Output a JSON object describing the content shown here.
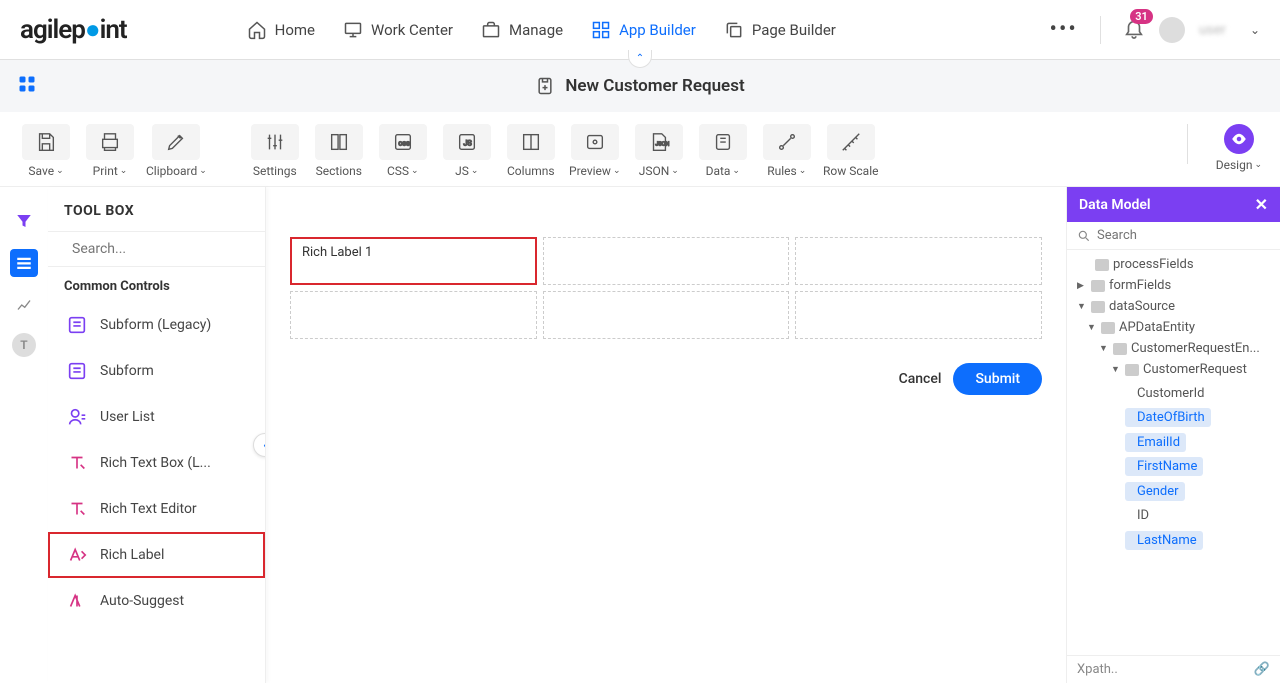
{
  "brand": "agilepoint",
  "nav": {
    "items": [
      {
        "label": "Home"
      },
      {
        "label": "Work Center"
      },
      {
        "label": "Manage"
      },
      {
        "label": "App Builder"
      },
      {
        "label": "Page Builder"
      }
    ],
    "badge": "31",
    "username": "user"
  },
  "breadcrumb": {
    "title": "New Customer Request"
  },
  "toolbar": {
    "save": "Save",
    "print": "Print",
    "clipboard": "Clipboard",
    "settings": "Settings",
    "sections": "Sections",
    "css": "CSS",
    "js": "JS",
    "columns": "Columns",
    "preview": "Preview",
    "json": "JSON",
    "data": "Data",
    "rules": "Rules",
    "rowscale": "Row Scale",
    "design": "Design"
  },
  "toolbox": {
    "title": "TOOL BOX",
    "search_placeholder": "Search...",
    "section": "Common Controls",
    "items": [
      {
        "label": "Subform (Legacy)"
      },
      {
        "label": "Subform"
      },
      {
        "label": "User List"
      },
      {
        "label": "Rich Text Box (L..."
      },
      {
        "label": "Rich Text Editor"
      },
      {
        "label": "Rich Label"
      },
      {
        "label": "Auto-Suggest"
      }
    ]
  },
  "canvas": {
    "field_label": "Rich Label 1",
    "cancel": "Cancel",
    "submit": "Submit"
  },
  "datamodel": {
    "title": "Data Model",
    "search_placeholder": "Search",
    "tree": {
      "processFields": "processFields",
      "formFields": "formFields",
      "dataSource": "dataSource",
      "apDataEntity": "APDataEntity",
      "customerRequestEn": "CustomerRequestEn...",
      "customerRequest": "CustomerRequest",
      "fields": [
        {
          "label": "CustomerId",
          "hl": false
        },
        {
          "label": "DateOfBirth",
          "hl": true
        },
        {
          "label": "EmailId",
          "hl": true
        },
        {
          "label": "FirstName",
          "hl": true
        },
        {
          "label": "Gender",
          "hl": true
        },
        {
          "label": "ID",
          "hl": false
        },
        {
          "label": "LastName",
          "hl": true
        }
      ]
    },
    "xpath": "Xpath.."
  }
}
